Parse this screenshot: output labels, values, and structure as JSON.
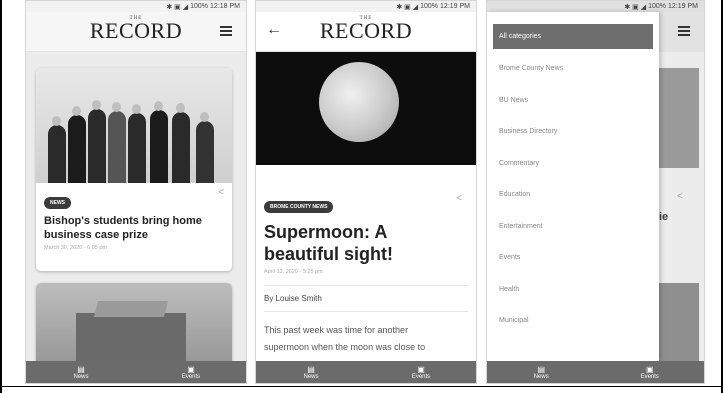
{
  "status_time_1": "12:18 PM",
  "status_time_2": "12:19 PM",
  "status_time_3": "12:19 PM",
  "battery": "100%",
  "logo_the": "THE",
  "logo": "RECORD",
  "list": {
    "card1": {
      "badge": "NEWS",
      "title_line1": "Bishop's students bring home",
      "title_line2": "business case prize",
      "date": "March 30, 2020 - 6:05 pm"
    }
  },
  "article": {
    "badge": "BROME COUNTY NEWS",
    "title_line1": "Supermoon:  A",
    "title_line2": "beautiful sight!",
    "date": "April 13, 2020 - 5:25 pm",
    "byline": "By Louise Smith",
    "body_line1": "This past week was time for another",
    "body_line2": "supermoon when the moon was close to"
  },
  "drawer": {
    "header": "All categories",
    "items": [
      "Brome County News",
      "BU News",
      "Business Directory",
      "Commentary",
      "Education",
      "Entertainment",
      "Events",
      "Health",
      "Municipal"
    ]
  },
  "behind_fragment": "ie",
  "nav": {
    "news": "News",
    "events": "Events"
  },
  "icons": {
    "news": "news-icon",
    "events": "events-icon",
    "menu": "hamburger-menu-icon",
    "back": "back-arrow-icon",
    "share": "share-icon"
  }
}
